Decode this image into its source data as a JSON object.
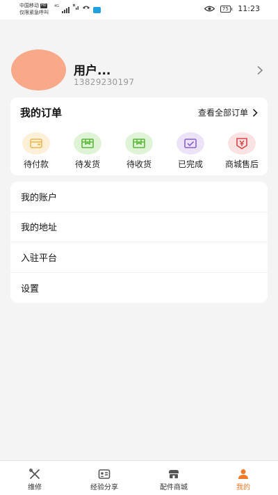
{
  "status_bar": {
    "carrier_line1": "中国移动",
    "hd_badge": "HD",
    "carrier_line2": "仅限紧急呼叫",
    "network": "4G",
    "battery": "75",
    "time": "11:23"
  },
  "profile": {
    "username": "用户...",
    "phone": "13829230197",
    "avatar_color": "#f8a98a"
  },
  "orders": {
    "title": "我的订单",
    "view_all": "查看全部订单",
    "items": [
      {
        "label": "待付款",
        "icon": "wallet-icon",
        "bg": "#fdf0d8",
        "color": "#f0b84a"
      },
      {
        "label": "待发货",
        "icon": "package-icon",
        "bg": "#dff3d6",
        "color": "#5cb83a"
      },
      {
        "label": "待收货",
        "icon": "package-icon",
        "bg": "#dff3d6",
        "color": "#5cb83a"
      },
      {
        "label": "已完成",
        "icon": "envelope-check-icon",
        "bg": "#ece3f8",
        "color": "#8a5fd0"
      },
      {
        "label": "商城售后",
        "icon": "yen-shield-icon",
        "bg": "#fbe3e3",
        "color": "#d84848"
      }
    ]
  },
  "menu": {
    "items": [
      {
        "label": "我的账户"
      },
      {
        "label": "我的地址"
      },
      {
        "label": "入驻平台"
      },
      {
        "label": "设置"
      }
    ]
  },
  "tabbar": {
    "accent_color": "#f07a2a",
    "tabs": [
      {
        "label": "维修",
        "icon": "tools-icon",
        "active": false
      },
      {
        "label": "经验分享",
        "icon": "id-card-icon",
        "active": false
      },
      {
        "label": "配件商城",
        "icon": "store-icon",
        "active": false
      },
      {
        "label": "我的",
        "icon": "person-icon",
        "active": true
      }
    ]
  }
}
